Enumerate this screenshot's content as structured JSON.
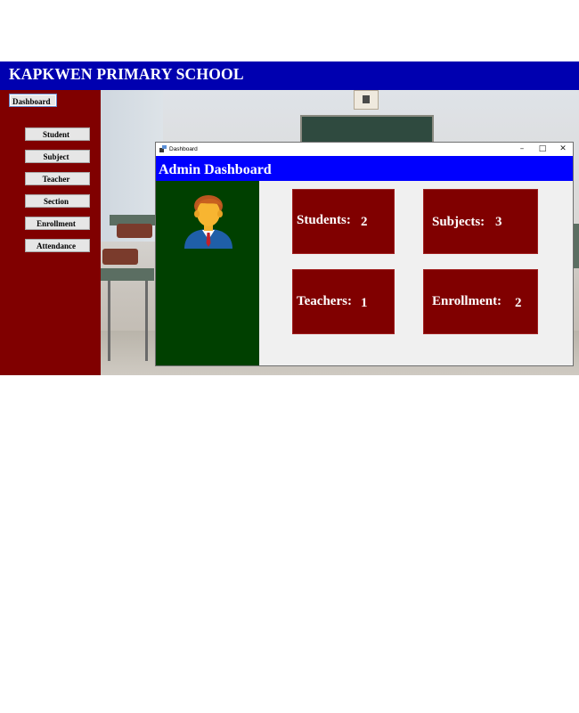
{
  "app": {
    "title": "KAPKWEN PRIMARY SCHOOL"
  },
  "sidebar": {
    "dashboard_label": "Dashboard",
    "items": [
      {
        "label": "Student"
      },
      {
        "label": "Subject"
      },
      {
        "label": "Teacher"
      },
      {
        "label": "Section"
      },
      {
        "label": "Enrollment"
      },
      {
        "label": "Attendance"
      }
    ]
  },
  "window": {
    "title": "Dashboard",
    "controls": {
      "minimize": "–",
      "maximize": "□",
      "close": "✕"
    },
    "header": "Admin Dashboard",
    "avatar_icon": "admin-user-icon",
    "stats": [
      {
        "label": "Students:",
        "value": "2"
      },
      {
        "label": "Subjects:",
        "value": "3"
      },
      {
        "label": "Teachers:",
        "value": "1"
      },
      {
        "label": "Enrollment:",
        "value": "2"
      }
    ]
  },
  "colors": {
    "header_blue": "#0000b0",
    "sidebar_maroon": "#800000",
    "dashboard_blue": "#0000ff",
    "panel_green": "#004000",
    "stat_box": "#800000"
  }
}
